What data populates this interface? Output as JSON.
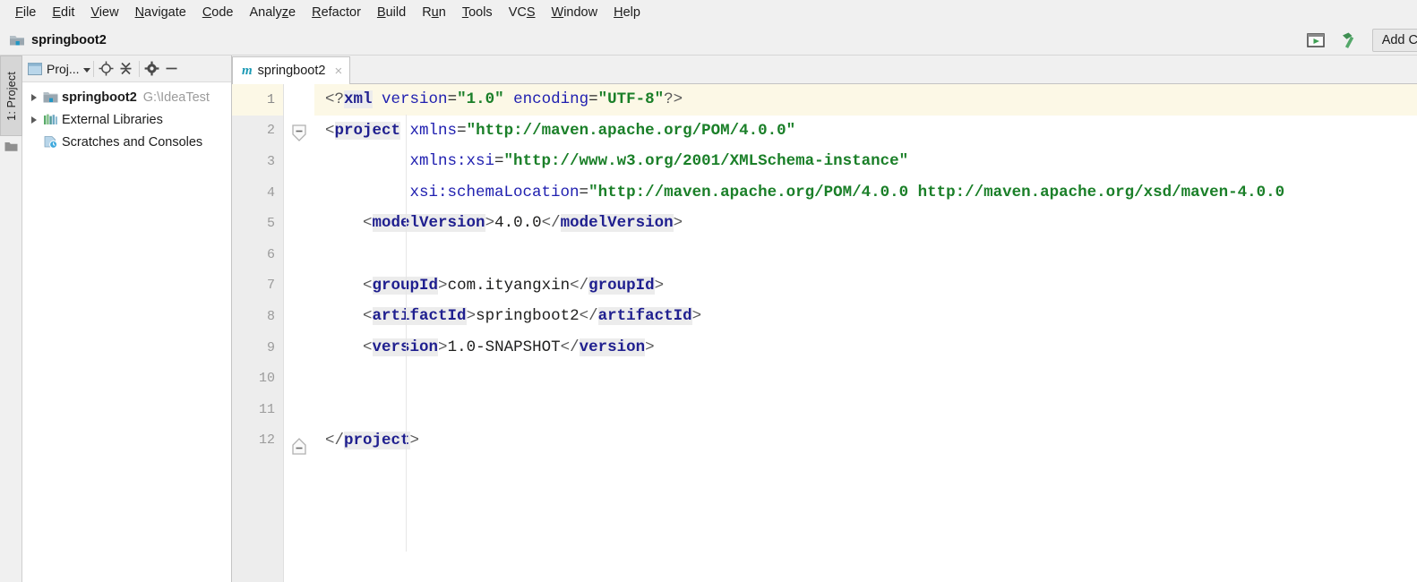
{
  "menubar": {
    "items": [
      {
        "label": "File",
        "mnemonic": "F"
      },
      {
        "label": "Edit",
        "mnemonic": "E"
      },
      {
        "label": "View",
        "mnemonic": "V"
      },
      {
        "label": "Navigate",
        "mnemonic": "N"
      },
      {
        "label": "Code",
        "mnemonic": "C"
      },
      {
        "label": "Analyze",
        "mnemonic": "z"
      },
      {
        "label": "Refactor",
        "mnemonic": "R"
      },
      {
        "label": "Build",
        "mnemonic": "B"
      },
      {
        "label": "Run",
        "mnemonic": "u"
      },
      {
        "label": "Tools",
        "mnemonic": "T"
      },
      {
        "label": "VCS",
        "mnemonic": "S"
      },
      {
        "label": "Window",
        "mnemonic": "W"
      },
      {
        "label": "Help",
        "mnemonic": "H"
      }
    ]
  },
  "titlebar": {
    "project_name": "springboot2",
    "folder_icon": "project-folder-icon",
    "run_icon": "run-console-icon",
    "build_icon": "build-hammer-icon",
    "add_button_label": "Add C"
  },
  "left_strip": {
    "tool_tab_label": "1: Project",
    "bottom_icon": "folder-icon"
  },
  "project_panel": {
    "title": "Proj...",
    "buttons": [
      {
        "name": "locate-target-icon"
      },
      {
        "name": "collapse-all-icon"
      },
      {
        "name": "settings-gear-icon"
      },
      {
        "name": "hide-minimize-icon"
      }
    ],
    "tree": [
      {
        "label": "springboot2",
        "path": "G:\\IdeaTest",
        "bold": true,
        "expandable": true,
        "icon": "module-folder-icon"
      },
      {
        "label": "External Libraries",
        "path": "",
        "bold": false,
        "expandable": true,
        "icon": "libraries-icon"
      },
      {
        "label": "Scratches and Consoles",
        "path": "",
        "bold": false,
        "expandable": false,
        "icon": "scratches-icon"
      }
    ]
  },
  "editor_tabs": [
    {
      "label": "springboot2",
      "icon": "maven-m-icon",
      "close": "×",
      "active": true
    }
  ],
  "editor": {
    "current_line": 1,
    "line_numbers": [
      1,
      2,
      3,
      4,
      5,
      6,
      7,
      8,
      9,
      10,
      11,
      12
    ],
    "fold_markers": [
      {
        "line": 2,
        "type": "fold-collapse-down-icon"
      },
      {
        "line": 12,
        "type": "fold-collapse-up-icon"
      }
    ],
    "lines": [
      [
        {
          "t": "<?",
          "c": "br"
        },
        {
          "t": "xml",
          "c": "tag"
        },
        {
          "t": " ",
          "c": "txt"
        },
        {
          "t": "version",
          "c": "att"
        },
        {
          "t": "=",
          "c": "eq"
        },
        {
          "t": "\"1.0\"",
          "c": "val"
        },
        {
          "t": " ",
          "c": "txt"
        },
        {
          "t": "encoding",
          "c": "att"
        },
        {
          "t": "=",
          "c": "eq"
        },
        {
          "t": "\"UTF-8\"",
          "c": "val"
        },
        {
          "t": "?>",
          "c": "br"
        }
      ],
      [
        {
          "t": "<",
          "c": "br"
        },
        {
          "t": "project",
          "c": "tag"
        },
        {
          "t": " ",
          "c": "txt"
        },
        {
          "t": "xmlns",
          "c": "att"
        },
        {
          "t": "=",
          "c": "eq"
        },
        {
          "t": "\"http://maven.apache.org/POM/4.0.0\"",
          "c": "val"
        }
      ],
      [
        {
          "t": "         ",
          "c": "txt"
        },
        {
          "t": "xmlns:xsi",
          "c": "att"
        },
        {
          "t": "=",
          "c": "eq"
        },
        {
          "t": "\"http://www.w3.org/2001/XMLSchema-instance\"",
          "c": "val"
        }
      ],
      [
        {
          "t": "         ",
          "c": "txt"
        },
        {
          "t": "xsi:schemaLocation",
          "c": "att"
        },
        {
          "t": "=",
          "c": "eq"
        },
        {
          "t": "\"http://maven.apache.org/POM/4.0.0 http://maven.apache.org/xsd/maven-4.0.0",
          "c": "val"
        }
      ],
      [
        {
          "t": "    ",
          "c": "txt"
        },
        {
          "t": "<",
          "c": "br"
        },
        {
          "t": "modelVersion",
          "c": "tag"
        },
        {
          "t": ">",
          "c": "br"
        },
        {
          "t": "4.0.0",
          "c": "txt"
        },
        {
          "t": "</",
          "c": "br"
        },
        {
          "t": "modelVersion",
          "c": "tag"
        },
        {
          "t": ">",
          "c": "br"
        }
      ],
      [],
      [
        {
          "t": "    ",
          "c": "txt"
        },
        {
          "t": "<",
          "c": "br"
        },
        {
          "t": "groupId",
          "c": "tag"
        },
        {
          "t": ">",
          "c": "br"
        },
        {
          "t": "com.ityangxin",
          "c": "txt"
        },
        {
          "t": "</",
          "c": "br"
        },
        {
          "t": "groupId",
          "c": "tag"
        },
        {
          "t": ">",
          "c": "br"
        }
      ],
      [
        {
          "t": "    ",
          "c": "txt"
        },
        {
          "t": "<",
          "c": "br"
        },
        {
          "t": "artifactId",
          "c": "tag"
        },
        {
          "t": ">",
          "c": "br"
        },
        {
          "t": "springboot2",
          "c": "txt"
        },
        {
          "t": "</",
          "c": "br"
        },
        {
          "t": "artifactId",
          "c": "tag"
        },
        {
          "t": ">",
          "c": "br"
        }
      ],
      [
        {
          "t": "    ",
          "c": "txt"
        },
        {
          "t": "<",
          "c": "br"
        },
        {
          "t": "version",
          "c": "tag"
        },
        {
          "t": ">",
          "c": "br"
        },
        {
          "t": "1.0-SNAPSHOT",
          "c": "txt"
        },
        {
          "t": "</",
          "c": "br"
        },
        {
          "t": "version",
          "c": "tag"
        },
        {
          "t": ">",
          "c": "br"
        }
      ],
      [],
      [],
      [
        {
          "t": "</",
          "c": "br"
        },
        {
          "t": "project",
          "c": "tag"
        },
        {
          "t": ">",
          "c": "br"
        }
      ]
    ]
  },
  "colors": {
    "chrome": "#f0f0f0",
    "editor_bg": "#ffffff",
    "gutter_bg": "#ededed",
    "caret_line": "#fcf8e6",
    "tag_name": "#1f1f8f",
    "attr_name": "#2020b0",
    "attr_value": "#1a7f28",
    "tag_highlight": "#ececec",
    "maven_icon": "#1c9ab5"
  }
}
